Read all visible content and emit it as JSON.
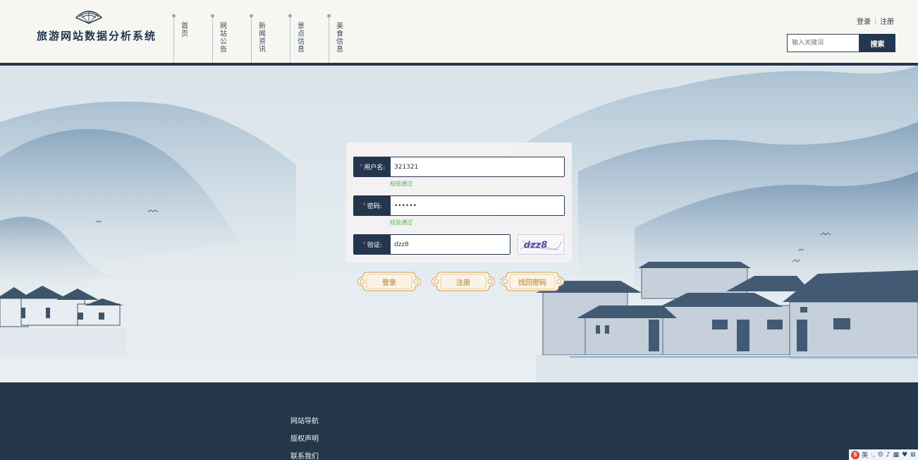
{
  "header": {
    "site_title": "旅游网站数据分析系统",
    "nav": [
      "首页",
      "网站公告",
      "新闻资讯",
      "景点信息",
      "美食信息"
    ],
    "login_link": "登录",
    "register_link": "注册",
    "search_placeholder": "输入关键词",
    "search_button": "搜索"
  },
  "login_form": {
    "username_label": "用户名:",
    "username_value": "321321",
    "username_status": "校验通过",
    "password_label": "密码:",
    "password_value": "321321",
    "password_status": "校验通过",
    "captcha_label": "验证:",
    "captcha_value": "dzz8",
    "captcha_image_text": "dzz8",
    "required_mark": "*"
  },
  "buttons": {
    "login": "登录",
    "register": "注册",
    "recover": "找回密码"
  },
  "footer": {
    "links": [
      "网站导航",
      "版权声明",
      "联系我们"
    ]
  },
  "ime_toolbar": {
    "logo": "S",
    "lang": "英"
  },
  "colors": {
    "primary": "#24364d",
    "accent_gold": "#c9a46a",
    "valid_green": "#4caf50",
    "required_red": "#d9534f"
  }
}
